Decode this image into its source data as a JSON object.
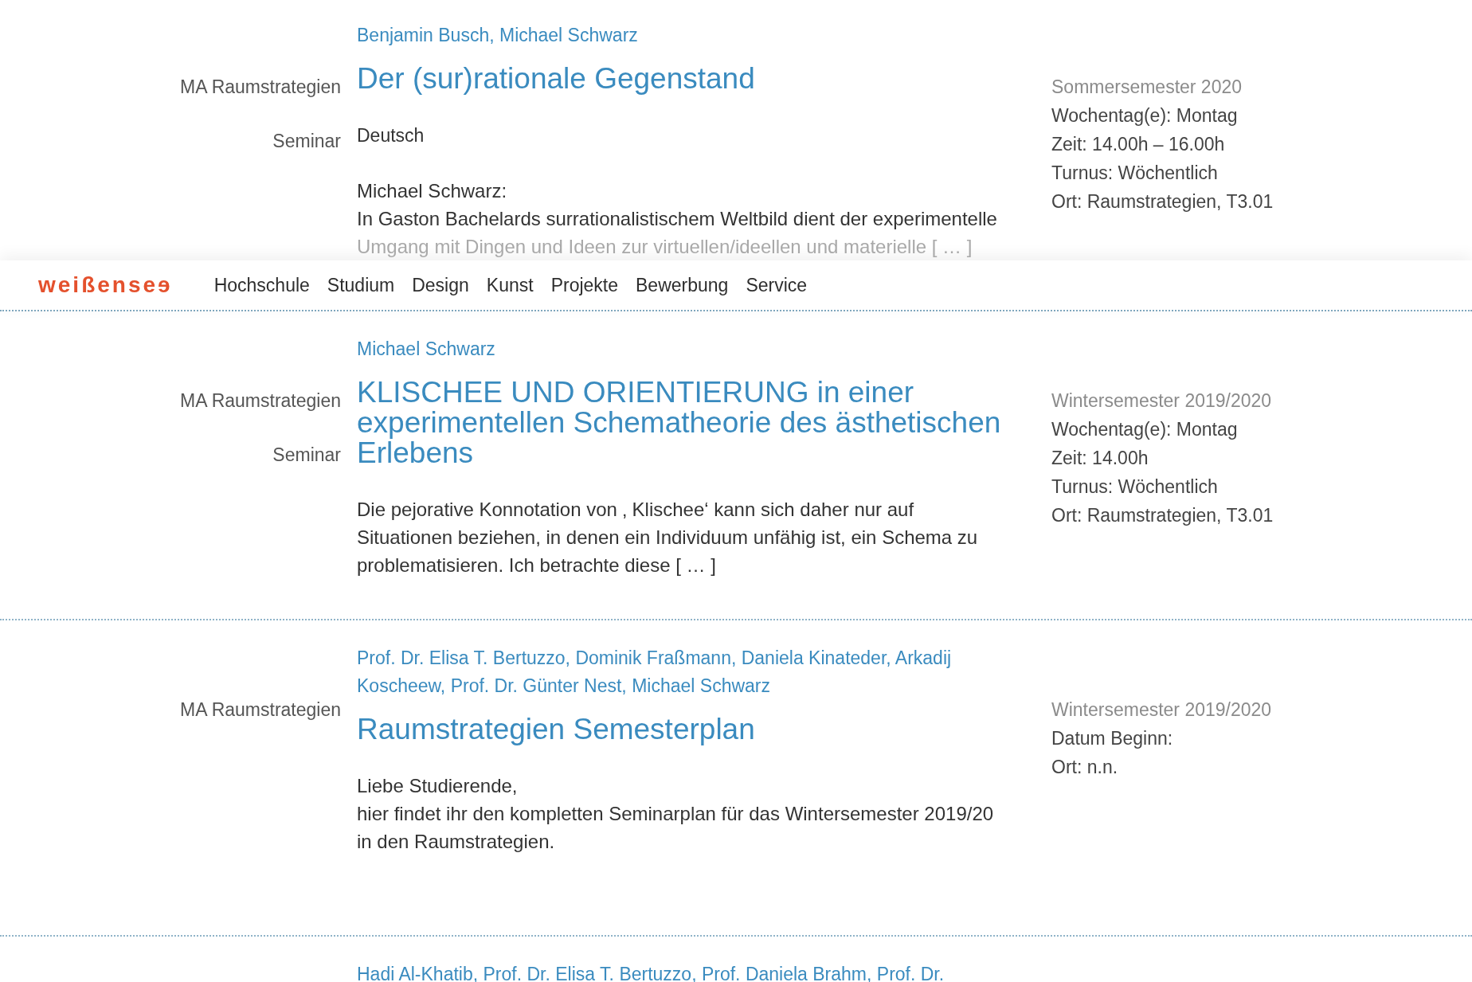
{
  "top_entry": {
    "authors": "Benjamin Busch, Michael Schwarz",
    "labels": [
      "MA Raumstrategien",
      "Seminar"
    ],
    "title": "Der (sur)rationale Gegenstand",
    "language": "Deutsch",
    "body": [
      {
        "text": "Michael Schwarz:",
        "faded": false
      },
      {
        "text": "In Gaston Bachelards surrationalistischem Weltbild dient der experimentelle",
        "faded": false
      },
      {
        "text": "Umgang mit Dingen und Ideen zur virtuellen/ideellen und materielle [ … ]",
        "faded": true
      }
    ],
    "semester": "Sommersemester 2020",
    "details": [
      "Wochentag(e): Montag",
      "Zeit: 14.00h – 16.00h",
      "Turnus: Wöchentlich",
      "Ort: Raumstrategien, T3.01"
    ]
  },
  "header": {
    "logo": "weißenseɘ",
    "nav": [
      "Hochschule",
      "Studium",
      "Design",
      "Kunst",
      "Projekte",
      "Bewerbung",
      "Service"
    ]
  },
  "entries": [
    {
      "authors": "Michael Schwarz",
      "labels": [
        "MA Raumstrategien",
        "Seminar"
      ],
      "title": "KLISCHEE UND ORIENTIERUNG in einer experimentellen Schematheorie des ästhetischen Erlebens",
      "body": [
        {
          "text": "Die pejorative Konnotation von ‚ Klischee‘ kann sich daher nur auf Situationen beziehen, in denen ein Individuum unfähig ist, ein Schema zu problematisieren. Ich betrachte diese [ … ]",
          "faded": false
        }
      ],
      "semester": "Wintersemester 2019/2020",
      "details": [
        "Wochentag(e): Montag",
        "Zeit: 14.00h",
        "Turnus: Wöchentlich",
        "Ort: Raumstrategien, T3.01"
      ]
    },
    {
      "authors": "Prof. Dr. Elisa T. Bertuzzo, Dominik Fraßmann, Daniela Kinateder, Arkadij Koscheew, Prof. Dr. Günter Nest, Michael Schwarz",
      "labels": [
        "MA Raumstrategien"
      ],
      "title": "Raumstrategien Semesterplan",
      "body": [
        {
          "text": "Liebe Studierende,",
          "faded": false
        },
        {
          "text": "hier findet ihr den kompletten Seminarplan für das Wintersemester 2019/20 in den Raumstrategien.",
          "faded": false
        }
      ],
      "semester": "Wintersemester 2019/2020",
      "details": [
        "Datum Beginn:",
        "Ort: n.n."
      ]
    },
    {
      "authors": "Hadi Al-Khatib, Prof. Dr. Elisa T. Bertuzzo, Prof. Daniela Brahm, Prof. Dr."
    }
  ]
}
